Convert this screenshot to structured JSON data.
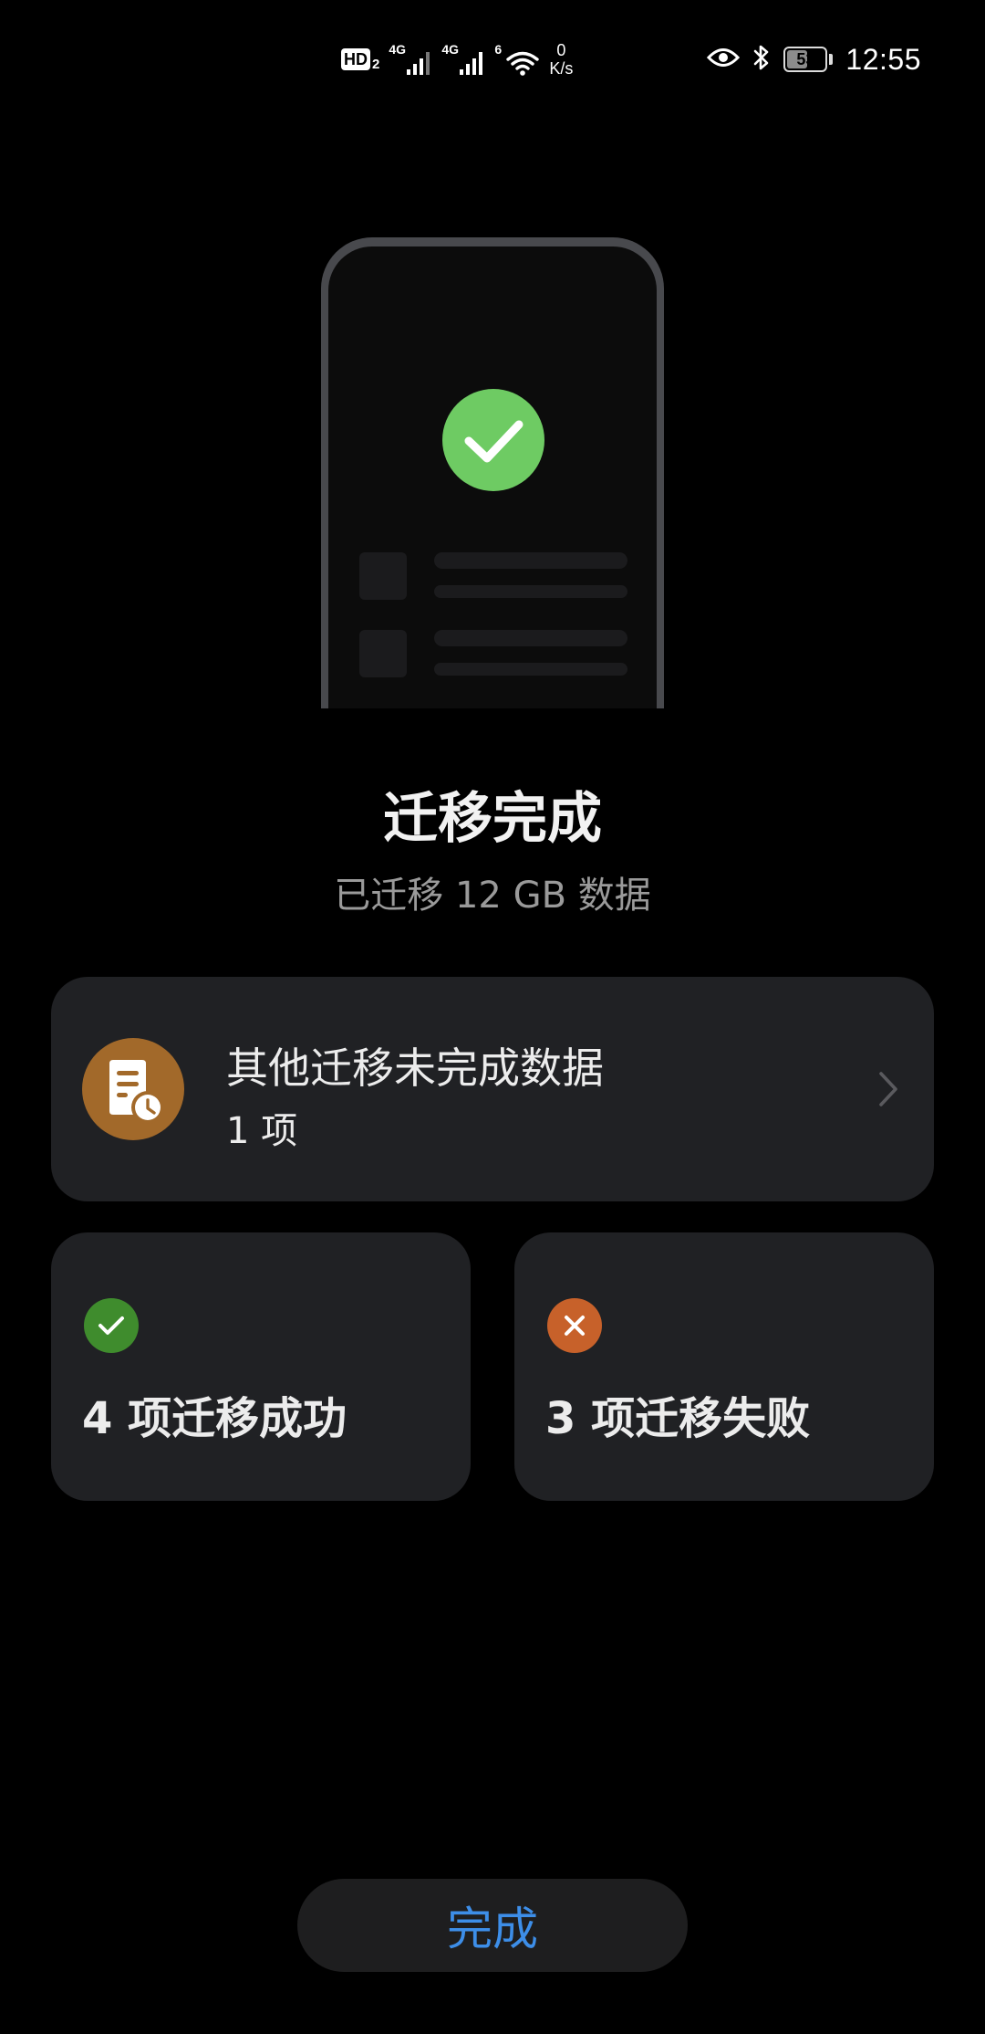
{
  "status_bar": {
    "hd_label": "HD",
    "hd_sub": "2",
    "signal_1_type": "4G",
    "signal_2_type": "4G",
    "wifi_type": "6",
    "net_speed_value": "0",
    "net_speed_unit": "K/s",
    "battery_level": "53",
    "time": "12:55",
    "icons": [
      "hd-voice-icon",
      "cell-signal-icon",
      "wifi-icon",
      "eye-icon",
      "bluetooth-icon",
      "battery-icon"
    ]
  },
  "illustration": {
    "icon": "check-circle-icon",
    "accent_color": "#6ecb63"
  },
  "header": {
    "title": "迁移完成",
    "subtitle": "已迁移 12 GB 数据"
  },
  "pending_card": {
    "title": "其他迁移未完成数据",
    "count_label": "1 项",
    "icon": "document-clock-icon",
    "icon_color": "#a2692a"
  },
  "result_cards": {
    "success": {
      "label": "4 项迁移成功",
      "icon": "check-icon",
      "color": "#3f8c2d"
    },
    "failed": {
      "label": "3 项迁移失败",
      "icon": "close-icon",
      "color": "#c7612a"
    }
  },
  "footer": {
    "done_label": "完成",
    "done_color": "#3d8ee8"
  }
}
